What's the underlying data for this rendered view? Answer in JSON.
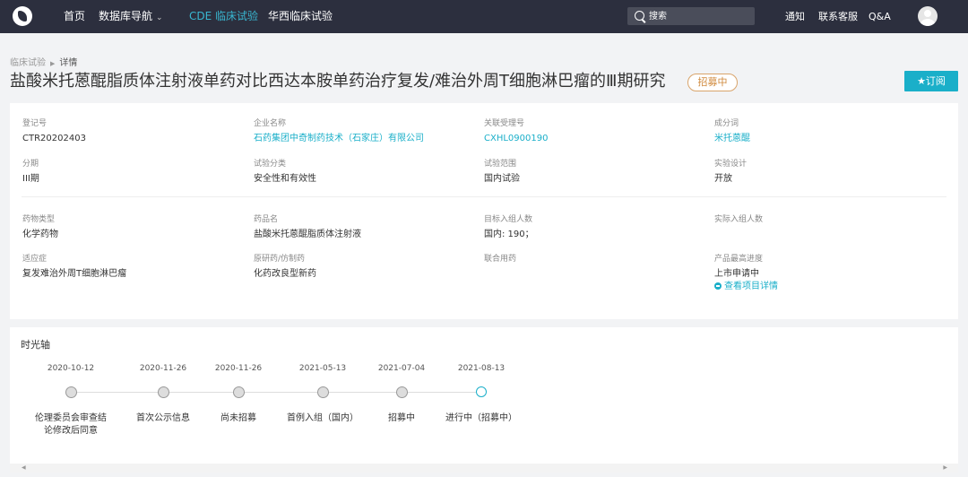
{
  "topbar": {
    "nav": [
      {
        "label": "首页"
      },
      {
        "label": "数据库导航"
      },
      {
        "label": "CDE 临床试验"
      },
      {
        "label": "华西临床试验"
      }
    ],
    "search_placeholder": "搜索",
    "links": [
      {
        "label": "通知"
      },
      {
        "label": "联系客服"
      },
      {
        "label": "Q&A"
      }
    ],
    "active_color": "#39b6d0"
  },
  "breadcrumb": {
    "parent": "临床试验",
    "current": "详情"
  },
  "page": {
    "title": "盐酸米托蒽醌脂质体注射液单药对比西达本胺单药治疗复发/难治外周T细胞淋巴瘤的Ⅲ期研究",
    "status_badge": "招募中",
    "subscribe_label": "★订阅",
    "accent_color": "#1aafc9"
  },
  "info": {
    "reg_no": {
      "label": "登记号",
      "value": "CTR20202403"
    },
    "company": {
      "label": "企业名称",
      "value": "石药集团中奇制药技术（石家庄）有限公司"
    },
    "accept_no": {
      "label": "关联受理号",
      "value": "CXHL0900190"
    },
    "ingredient": {
      "label": "成分词",
      "value": "米托蒽醌"
    },
    "phase": {
      "label": "分期",
      "value": "III期"
    },
    "category": {
      "label": "试验分类",
      "value": "安全性和有效性"
    },
    "scope": {
      "label": "试验范围",
      "value": "国内试验"
    },
    "design": {
      "label": "实验设计",
      "value": "开放"
    },
    "drug_type": {
      "label": "药物类型",
      "value": "化学药物"
    },
    "drug_name": {
      "label": "药品名",
      "value": "盐酸米托蒽醌脂质体注射液"
    },
    "target_enroll": {
      "label": "目标入组人数",
      "value": "国内: 190；"
    },
    "actual_enroll": {
      "label": "实际入组人数",
      "value": ""
    },
    "indication": {
      "label": "适应症",
      "value": "复发难治外周T细胞淋巴瘤"
    },
    "origin": {
      "label": "原研药/仿制药",
      "value": "化药改良型新药"
    },
    "combo": {
      "label": "联合用药",
      "value": ""
    },
    "progress": {
      "label": "产品最高进度",
      "value": "上市申请中",
      "link": "查看项目详情"
    }
  },
  "timeline": {
    "title": "时光轴",
    "events": [
      {
        "date": "2020-10-12",
        "label": "伦理委员会审查结论修改后同意"
      },
      {
        "date": "2020-11-26",
        "label": "首次公示信息"
      },
      {
        "date": "2020-11-26",
        "label": "尚未招募"
      },
      {
        "date": "2021-05-13",
        "label": "首例入组（国内）"
      },
      {
        "date": "2021-07-04",
        "label": "招募中"
      },
      {
        "date": "2021-08-13",
        "label": "进行中（招募中）",
        "current": true
      }
    ]
  }
}
